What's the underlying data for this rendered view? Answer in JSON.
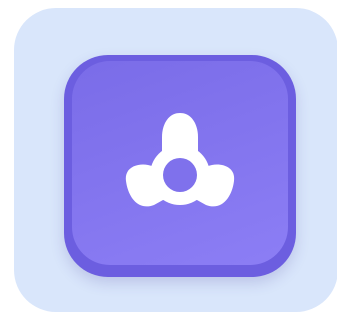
{
  "icon": {
    "name": "fidget-spinner-icon"
  },
  "colors": {
    "background_tile": "#d9e6fb",
    "icon_outer": "#6c5ee0",
    "icon_inner_top": "#7a6ce8",
    "icon_inner_bottom": "#8c7ef5",
    "glyph": "#ffffff",
    "glyph_hole": "#7f71ec"
  }
}
